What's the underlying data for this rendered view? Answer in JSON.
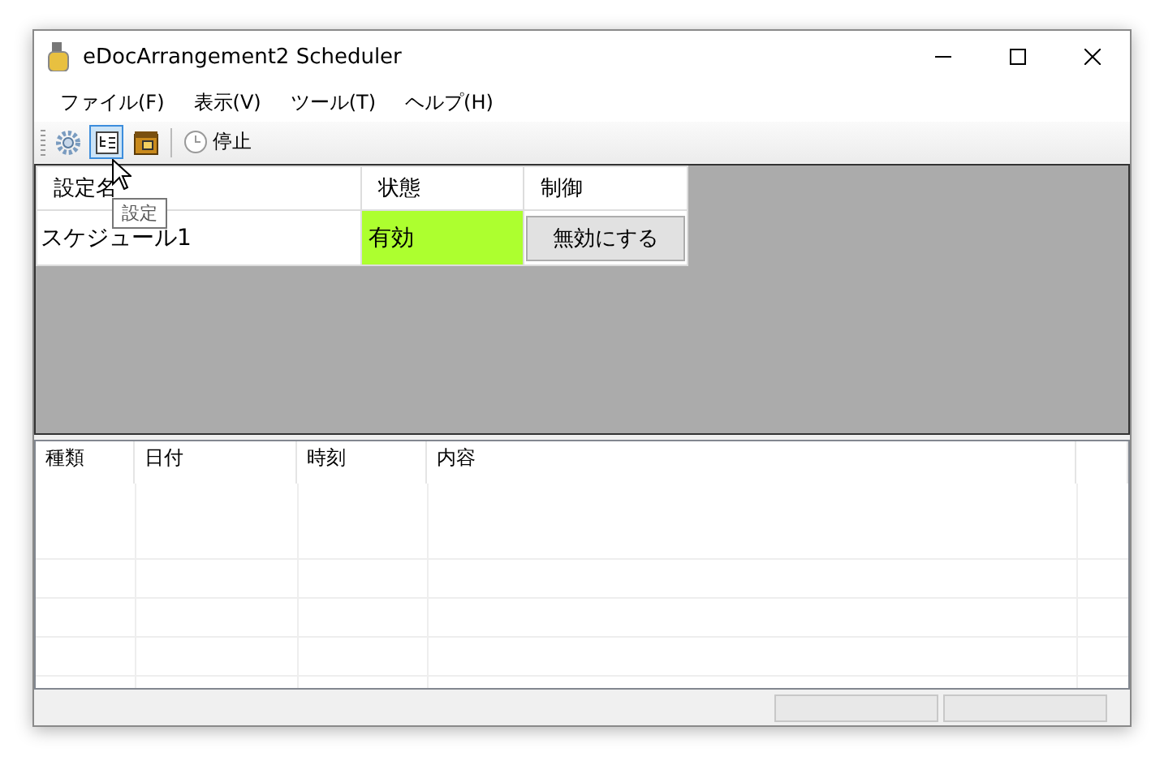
{
  "window": {
    "title": "eDocArrangement2 Scheduler"
  },
  "menu": [
    "ファイル(F)",
    "表示(V)",
    "ツール(T)",
    "ヘルプ(H)"
  ],
  "toolbar": [
    {
      "kind": "gear",
      "selected": false
    },
    {
      "kind": "list",
      "selected": true
    },
    {
      "kind": "box",
      "selected": false
    },
    {
      "kind": "separator"
    },
    {
      "kind": "clock",
      "label": "停止",
      "selected": false
    }
  ],
  "tooltip": "設定",
  "schedules": {
    "columns": [
      "設定名",
      "状態",
      "制御"
    ],
    "rows": [
      {
        "name": "スケジュール1",
        "status": "有効",
        "enabled": true,
        "action": "無効にする"
      }
    ]
  },
  "log": {
    "columns": [
      "種類",
      "日付",
      "時刻",
      "内容"
    ]
  }
}
